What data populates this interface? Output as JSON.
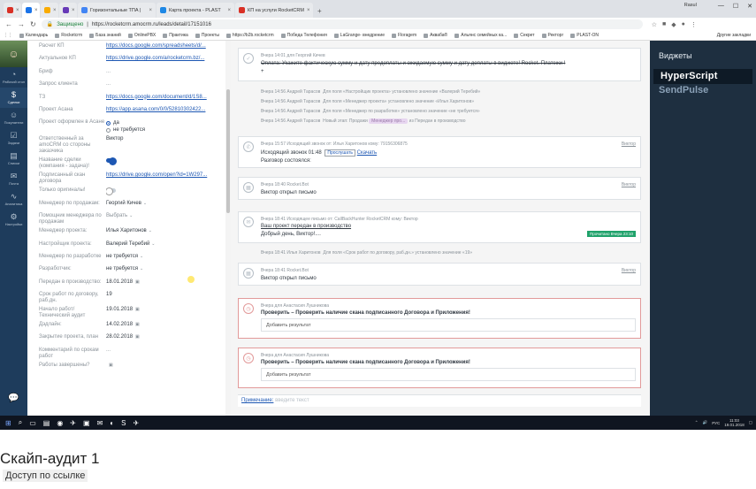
{
  "browser": {
    "tabs": [
      {
        "label": "",
        "color": "#d93025"
      },
      {
        "label": "",
        "color": "#1a73e8"
      },
      {
        "label": "",
        "color": "#f9ab00"
      },
      {
        "label": "",
        "color": "#673ab7"
      },
      {
        "label": "Горизонтальные ТПА |",
        "color": "#4285f4"
      },
      {
        "label": "Карта проекта - PLAST",
        "color": "#1e88e5"
      },
      {
        "label": "КП на услуги RocketCRM",
        "color": "#d93025"
      }
    ],
    "user": "Rasul",
    "secure_label": "Защищено",
    "url": "https://rocketcrm.amocrm.ru/leads/detail/17151016",
    "bookmarks": [
      "Календарь",
      "Rocketcrm",
      "База знаний",
      "OnlinePBX",
      "Практика",
      "Проекты",
      "https://b2b.rocketcrm",
      "Победа Телефония",
      "LaGrange- внедрение",
      "Floragem",
      "Акваба®",
      "Альянс семейных ка...",
      "Секрет",
      "Ректорг",
      "PLAST-ON"
    ],
    "other_bookmarks": "Другие закладки"
  },
  "left_nav": [
    {
      "label": "Рабочий стол",
      "icon": "◔"
    },
    {
      "label": "Сделки",
      "icon": "$",
      "active": true
    },
    {
      "label": "Покупатели",
      "icon": "☺"
    },
    {
      "label": "Задачи",
      "icon": "☑"
    },
    {
      "label": "Списки",
      "icon": "▤"
    },
    {
      "label": "Почта",
      "icon": "✉"
    },
    {
      "label": "Аналитика",
      "icon": "∿"
    },
    {
      "label": "Настройки",
      "icon": "⚙"
    }
  ],
  "fields": [
    {
      "label": "Расчет КП",
      "value": "https://docs.google.com/spreadsheets/d/...",
      "type": "link"
    },
    {
      "label": "Актуальное КП",
      "value": "https://drive.google.com/a/rocketcrm.bz/...",
      "type": "link"
    },
    {
      "label": "Бриф",
      "value": "...",
      "type": "muted"
    },
    {
      "label": "Запрос клиента",
      "value": "...",
      "type": "muted"
    },
    {
      "label": "ТЗ",
      "value": "https://docs.google.com/document/d/1S8...",
      "type": "link"
    },
    {
      "label": "Проект Асана",
      "value": "https://app.asana.com/0/0/52810302422...",
      "type": "link"
    },
    {
      "label": "Проект оформлен в Асане",
      "type": "radio",
      "options": [
        "да",
        "не требуется"
      ],
      "selected": 0
    },
    {
      "label": "Ответственный за amoCRM со стороны заказчика",
      "value": "Виктор",
      "type": "text"
    },
    {
      "label": "Название сделки (компания - задача)!",
      "type": "toggle",
      "on": true
    },
    {
      "label": "Подписанный скан договора",
      "value": "https://drive.google.com/open?id=1W297...",
      "type": "link"
    },
    {
      "label": "Только оригиналы!",
      "type": "toggle",
      "on": false
    },
    {
      "label": "Менеджер по продажам:",
      "value": "Георгий Кичев",
      "type": "select"
    },
    {
      "label": "Помощник менеджера по продажам",
      "value": "Выбрать",
      "type": "select",
      "muted": true
    },
    {
      "label": "Менеджер проекта:",
      "value": "Илья Харитонов",
      "type": "select"
    },
    {
      "label": "Настройщик проекта:",
      "value": "Валерий Теребий",
      "type": "select"
    },
    {
      "label": "Менеджер по разработке",
      "value": "не требуется",
      "type": "select"
    },
    {
      "label": "Разработчик:",
      "value": "не требуется",
      "type": "select"
    },
    {
      "label": "Передан в производство:",
      "value": "18.01.2018",
      "type": "date"
    },
    {
      "label": "Срок работ по договору, раб.дн.",
      "value": "19",
      "type": "text"
    },
    {
      "label": "Начало работ/ Технический аудит",
      "value": "19.01.2018",
      "type": "date"
    },
    {
      "label": "Дэдлайн:",
      "value": "14.02.2018",
      "type": "date"
    },
    {
      "label": "Закрытие проекта, план",
      "value": "28.02.2018",
      "type": "date"
    },
    {
      "label": "Комментарий по срокам работ",
      "value": "...",
      "type": "muted"
    },
    {
      "label": "Работы завершены?",
      "value": "",
      "type": "date"
    }
  ],
  "feed": {
    "task_done": {
      "meta": "Вчера 14:01 для Георгий Кичев",
      "text": "Оплата: Укажите фактическую сумму и дату предоплаты и ожидаемую сумму и дату доплаты в виджете! Rocket. Платежи !",
      "extra": "+"
    },
    "system_lines": [
      {
        "time": "Вчера 14:56 Андрей Тарасов",
        "text": "Для поля «Настройщик проекта» установлено значение «Валерий Теребий»"
      },
      {
        "time": "Вчера 14:56 Андрей Тарасов",
        "text": "Для поля «Менеджер проекта» установлено значение «Илья Харитонов»"
      },
      {
        "time": "Вчера 14:56 Андрей Тарасов",
        "text": "Для поля «Менеджер по разработке» установлено значение «не требуется»"
      },
      {
        "time": "Вчера 14:56 Андрей Тарасов",
        "text": "Новый этап: Продажи",
        "stage": "Менеджер про...",
        "after": "из Передан в производство"
      }
    ],
    "call": {
      "meta": "Вчера 15:57 Исходящий звонок от: Илья Харитонов кому: 79156306875",
      "author": "Виктор",
      "line1": "Исходящий звонок 01:48",
      "listen": "Прослушать",
      "download": "Скачать",
      "line2": "Разговор состоялся:"
    },
    "email_open1": {
      "meta": "Вчера 18:40 Rocket.Bot",
      "author": "Виктор",
      "text": "Виктор открыл письмо"
    },
    "email": {
      "meta": "Вчера 18:41 Исходящее письмо от: CallBackHunter RocketCRM кому: Виктор",
      "subject": "Ваш проект передан в производство",
      "body": "Добрый день, Виктор!....",
      "badge": "Прочитано Вчера 23:10"
    },
    "field_line": {
      "time": "Вчера 18:41 Илья Харитонов",
      "text": "Для поля «Срок работ по договору, раб.дн.» установлено значение «19»"
    },
    "email_open2": {
      "meta": "Вчера 18:41 Rocket.Bot",
      "author": "Виктор",
      "text": "Виктор открыл письмо"
    },
    "tasks": [
      {
        "meta": "Вчера для Анастасия Лушникова",
        "title": "Проверить – Проверить наличие скана подписанного Договора и Приложения!",
        "result_placeholder": "Добавить результат"
      },
      {
        "meta": "Вчера для Анастасия Лушникова",
        "title": "Проверить – Проверить наличие скана подписанного Договора и Приложения!",
        "result_placeholder": "Добавить результат"
      }
    ],
    "note_label": "Примечание:",
    "note_placeholder": "введите текст"
  },
  "widgets": {
    "title": "Виджеты",
    "hyperscript": "HyperScript",
    "sendpulse": "SendPulse"
  },
  "taskbar": {
    "lang": "РУС",
    "time": "11:03",
    "date": "19.01.2018"
  },
  "video": {
    "title": "Скайп-аудит 1",
    "access": "Доступ по ссылке"
  }
}
